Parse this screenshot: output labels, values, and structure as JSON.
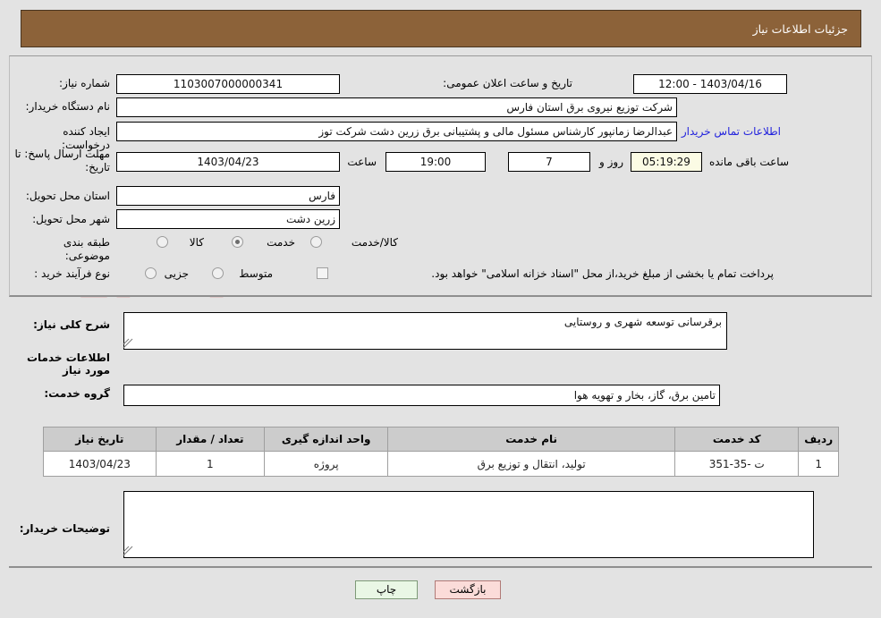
{
  "header": {
    "title": "جزئیات اطلاعات نیاز"
  },
  "form": {
    "need_number": {
      "label": "شماره نیاز:",
      "value": "1103007000000341"
    },
    "announce_datetime": {
      "label": "تاریخ و ساعت اعلان عمومی:",
      "value": "1403/04/16 - 12:00"
    },
    "buyer_org": {
      "label": "نام دستگاه خریدار:",
      "value": "شرکت توزیع نیروی برق استان فارس"
    },
    "requester": {
      "label": "ایجاد کننده درخواست:",
      "value": "عبدالرضا  زمانپور کارشناس مسئول مالی و پشتیبانی برق زرین دشت شرکت توز",
      "contact_link": "اطلاعات تماس خریدار"
    },
    "deadline": {
      "label": "مهلت ارسال پاسخ: تا تاریخ:",
      "date": "1403/04/23",
      "time_label": "ساعت",
      "time": "19:00",
      "days": "7",
      "days_label": "روز و",
      "countdown": "05:19:29",
      "countdown_label": "ساعت باقی مانده"
    },
    "province": {
      "label": "استان محل تحویل:",
      "value": "فارس"
    },
    "city": {
      "label": "شهر محل تحویل:",
      "value": "زرین دشت"
    },
    "category": {
      "label": "طبقه بندی موضوعی:",
      "options": [
        "کالا",
        "خدمت",
        "کالا/خدمت"
      ],
      "selected": "خدمت"
    },
    "process_type": {
      "label": "نوع فرآیند خرید :",
      "options": [
        "جزیی",
        "متوسط"
      ],
      "selected": "",
      "note": "پرداخت تمام یا بخشی از مبلغ خرید،از محل \"اسناد خزانه اسلامی\" خواهد بود.",
      "note_checked": false
    },
    "general_description": {
      "label": "شرح کلی نیاز:",
      "value": "برقرسانی توسعه شهری و روستایی"
    },
    "services_section_title": "اطلاعات خدمات مورد نیاز",
    "service_group": {
      "label": "گروه خدمت:",
      "value": "تامین برق، گاز، بخار و تهویه هوا"
    },
    "buyer_notes": {
      "label": "توضیحات خریدار:",
      "value": ""
    }
  },
  "table": {
    "columns": [
      "ردیف",
      "کد خدمت",
      "نام خدمت",
      "واحد اندازه گیری",
      "تعداد / مقدار",
      "تاریخ نیاز"
    ],
    "rows": [
      {
        "index": "1",
        "service_code": "ت -35-351",
        "service_name": "تولید، انتقال و توزیع برق",
        "unit": "پروژه",
        "quantity": "1",
        "need_date": "1403/04/23"
      }
    ]
  },
  "buttons": {
    "print": "چاپ",
    "back": "بازگشت"
  },
  "colors": {
    "header_bg": "#8c6239",
    "page_bg": "#e3e3e3",
    "link": "#2222dd",
    "countdown_bg": "#fbfbe4",
    "table_header_bg": "#cccccc",
    "print_btn_bg": "#e9f7e5",
    "back_btn_bg": "#fbdcd9"
  },
  "watermark": {
    "text": "AriaTender.net"
  }
}
